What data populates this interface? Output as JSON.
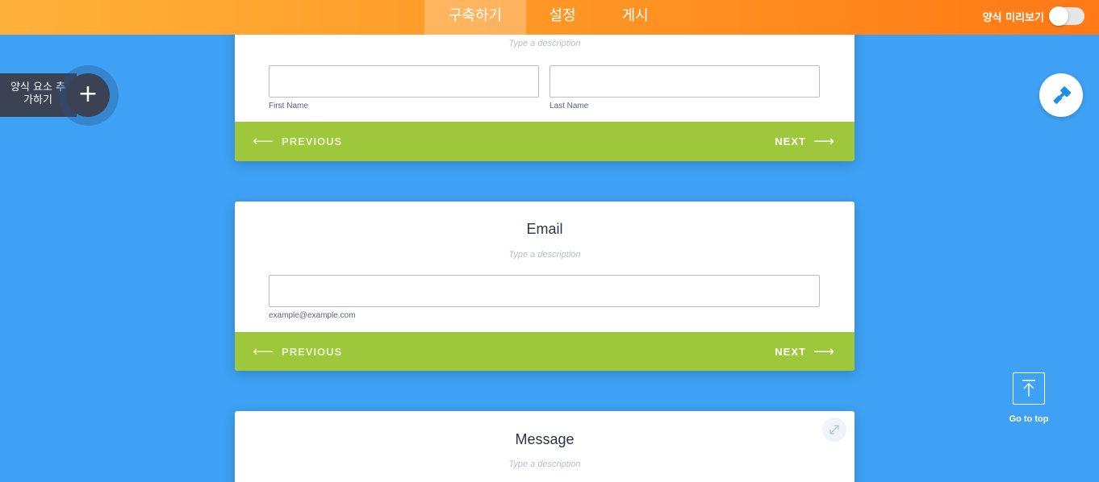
{
  "header": {
    "tabs": [
      {
        "label": "구축하기",
        "active": true
      },
      {
        "label": "설정",
        "active": false
      },
      {
        "label": "게시",
        "active": false
      }
    ],
    "preview_label": "양식 미리보기",
    "preview_on": false,
    "colors": {
      "gradient_start": "#ffb23b",
      "gradient_end": "#ff7914"
    }
  },
  "sidebar": {
    "add_element_label": "양식 요소 추가하기",
    "add_icon": "plus-icon"
  },
  "right_tools": {
    "paint_icon": "paint-roller-icon",
    "go_to_top_label": "Go to top",
    "go_to_top_icon": "arrow-up-icon"
  },
  "cards": [
    {
      "description": "Type a description",
      "fields": [
        {
          "value": "",
          "sublabel": "First Name"
        },
        {
          "value": "",
          "sublabel": "Last Name"
        }
      ],
      "prev_label": "PREVIOUS",
      "next_label": "NEXT"
    },
    {
      "title": "Email",
      "description": "Type a description",
      "field": {
        "value": "",
        "sublabel": "example@example.com"
      },
      "prev_label": "PREVIOUS",
      "next_label": "NEXT"
    },
    {
      "title": "Message",
      "description": "Type a description",
      "expand_icon": "expand-icon"
    }
  ],
  "colors": {
    "background": "#3ea1f3",
    "nav_bar": "#9fc73c",
    "dark_button": "#3b4253"
  }
}
